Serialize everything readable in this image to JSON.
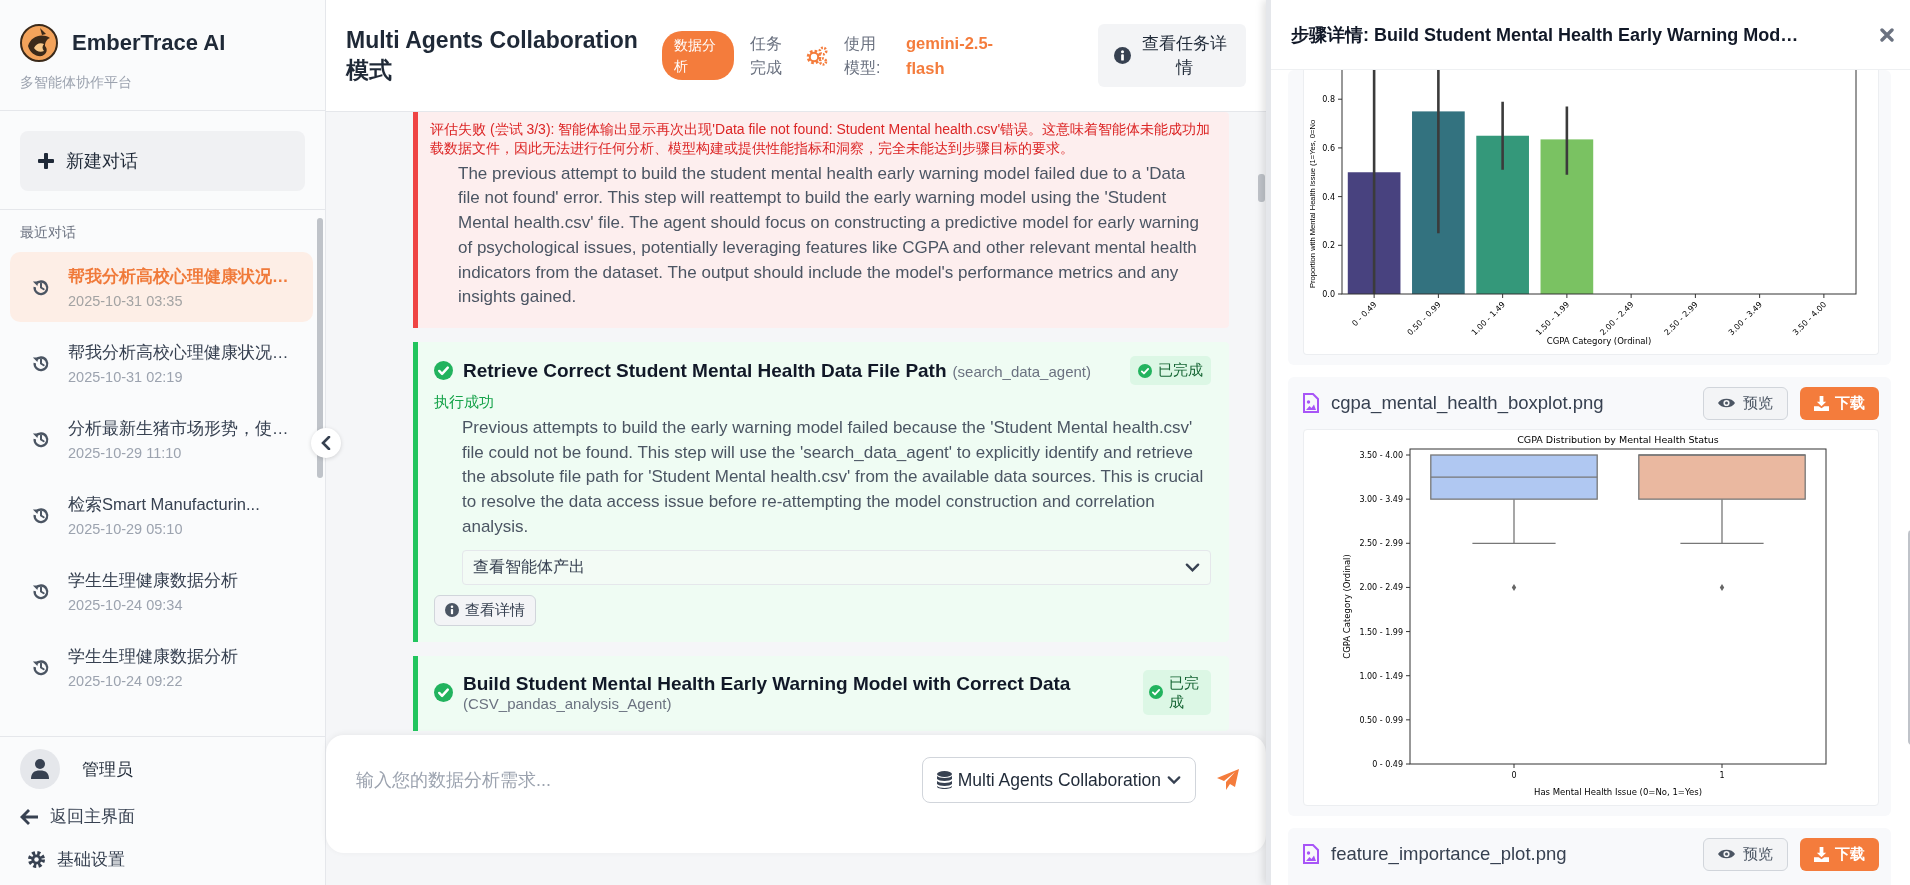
{
  "sidebar": {
    "app_name": "EmberTrace AI",
    "tagline": "多智能体协作平台",
    "new_chat_button": "新建对话",
    "recent_heading": "最近对话",
    "conversations": [
      {
        "title": "帮我分析高校心理健康状况…",
        "time": "2025-10-31 03:35",
        "selected": true
      },
      {
        "title": "帮我分析高校心理健康状况…",
        "time": "2025-10-31 02:19",
        "selected": false
      },
      {
        "title": "分析最新生猪市场形势，使…",
        "time": "2025-10-29 11:10",
        "selected": false
      },
      {
        "title": "检索Smart Manufacturin...",
        "time": "2025-10-29 05:10",
        "selected": false
      },
      {
        "title": "学生生理健康数据分析",
        "time": "2025-10-24 09:34",
        "selected": false
      },
      {
        "title": "学生生理健康数据分析",
        "time": "2025-10-24 09:22",
        "selected": false
      }
    ],
    "user": {
      "name": "管理员"
    },
    "links": [
      {
        "kind": "back",
        "label": "返回主界面"
      },
      {
        "kind": "settings",
        "label": "基础设置"
      }
    ]
  },
  "header": {
    "title": "Multi Agents Collaboration 模式",
    "tag": "数据分析",
    "status": "任务完成",
    "model_label": "使用模型:",
    "model": "gemini-2.5-flash",
    "details_button": "查看任务详情"
  },
  "steps": [
    {
      "kind": "failed",
      "evaluation": "评估失败 (尝试 3/3): 智能体输出显示再次出现'Data file not found: Student Mental health.csv'错误。这意味着智能体未能成功加载数据文件，因此无法进行任何分析、模型构建或提供性能指标和洞察，完全未能达到步骤目标的要求。",
      "description": "The previous attempt to build the student mental health early warning model failed due to a 'Data file not found' error. This step will reattempt to build the early warning model using the 'Student Mental health.csv' file. The agent should focus on constructing a predictive model for early warning of psychological issues, potentially leveraging features like CGPA and other relevant mental health indicators from the dataset. The output should include the model's performance metrics and any insights gained."
    },
    {
      "kind": "done",
      "title": "Retrieve Correct Student Mental Health Data File Path",
      "agent": "(search_data_agent)",
      "badge": "已完成",
      "result": "执行成功",
      "description": "Previous attempts to build the early warning model failed because the 'Student Mental health.csv' file could not be found. This step will use the 'search_data_agent' to explicitly identify and retrieve the absolute file path for 'Student Mental health.csv' from the available data sources. This is crucial to resolve the data access issue before re-attempting the model construction and correlation analysis.",
      "output_toggle": "查看智能体产出",
      "details_button": "查看详情"
    },
    {
      "kind": "done",
      "title": "Build Student Mental Health Early Warning Model with Correct Data",
      "agent": "(CSV_pandas_analysis_Agent)",
      "badge": "已完成"
    }
  ],
  "input": {
    "placeholder": "输入您的数据分析需求...",
    "mode": "Multi Agents Collaboration"
  },
  "detail_panel": {
    "title": "步骤详情: Build Student Mental Health Early Warning Mod…",
    "files": [
      {
        "chart_data": {
          "type": "bar",
          "xlabel": "CGPA Category (Ordinal)",
          "ylabel": "Proportion with Mental Health Issue (1=Yes, 0=No",
          "categories": [
            "0 - 0.49",
            "0.50 - 0.99",
            "1.00 - 1.49",
            "1.50 - 1.99",
            "2.00 - 2.49",
            "2.50 - 2.99",
            "3.00 - 3.49",
            "3.50 - 4.00"
          ],
          "series": [
            {
              "color": "#48427f",
              "values": [
                0.5,
                null,
                null,
                null,
                null,
                null,
                null,
                null
              ],
              "errors": [
                [
                  0,
                  0.92
                ],
                null,
                null,
                null,
                null,
                null,
                null,
                null
              ]
            },
            {
              "color": "#33727f",
              "values": [
                null,
                0.75,
                null,
                null,
                null,
                null,
                null,
                null
              ],
              "errors": [
                null,
                [
                  0.25,
                  0.92
                ],
                null,
                null,
                null,
                null,
                null,
                null
              ]
            },
            {
              "color": "#34987a",
              "values": [
                null,
                null,
                0.65,
                null,
                null,
                null,
                null,
                null
              ],
              "errors": [
                null,
                null,
                [
                  0.51,
                  0.79
                ],
                null,
                null,
                null,
                null,
                null
              ]
            },
            {
              "color": "#7ac262",
              "values": [
                null,
                null,
                null,
                0.635,
                null,
                null,
                null,
                null
              ],
              "errors": [
                null,
                null,
                null,
                [
                  0.49,
                  0.77
                ],
                null,
                null,
                null,
                null
              ]
            }
          ],
          "ylim": [
            0,
            0.92
          ],
          "yticks": [
            {
              "value": 0,
              "label": "0.0"
            },
            {
              "value": 0.2,
              "label": "0.2"
            },
            {
              "value": 0.4,
              "label": "0.4"
            },
            {
              "value": 0.6,
              "label": "0.6"
            },
            {
              "value": 0.8,
              "label": "0.8"
            }
          ]
        }
      },
      {
        "name": "cgpa_mental_health_boxplot.png",
        "preview_button": "预览",
        "download_button": "下载",
        "boxplot": {
          "title": "CGPA Distribution by Mental Health Status",
          "xlabel": "Has Mental Health Issue (0=No, 1=Yes)",
          "ylabel": "CGPA Category (Ordinal)",
          "xticks": [
            "0",
            "1"
          ],
          "yticks": [
            "3.50 - 4.00",
            "3.00 - 3.49",
            "2.50 - 2.99",
            "2.00 - 2.49",
            "1.50 - 1.99",
            "1.00 - 1.49",
            "0.50 - 0.99",
            "0 - 0.49"
          ]
        }
      },
      {
        "name": "feature_importance_plot.png",
        "preview_button": "预览",
        "download_button": "下载"
      }
    ]
  }
}
